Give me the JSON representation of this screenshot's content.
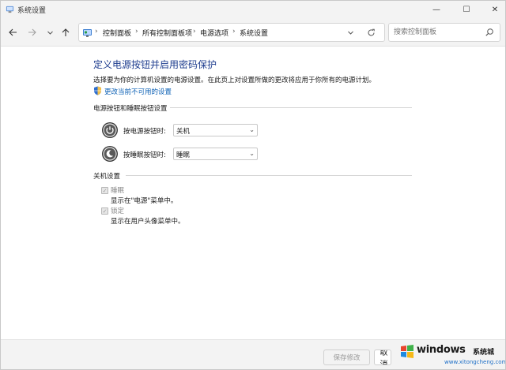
{
  "window": {
    "title": "系统设置",
    "minimize_glyph": "—",
    "maximize_glyph": "☐",
    "close_glyph": "✕"
  },
  "nav": {
    "back_icon": "arrow-left-icon",
    "forward_icon": "arrow-right-icon",
    "recent_icon": "chevron-down-icon",
    "up_icon": "arrow-up-icon"
  },
  "address": {
    "breadcrumbs": [
      "控制面板",
      "所有控制面板项",
      "电源选项",
      "系统设置"
    ],
    "separator": "›"
  },
  "search": {
    "placeholder": "搜索控制面板"
  },
  "main": {
    "title": "定义电源按钮并启用密码保护",
    "description": "选择要为你的计算机设置的电源设置。在此页上对设置所做的更改将应用于你所有的电源计划。",
    "change_link": "更改当前不可用的设置",
    "power_section": {
      "title": "电源按钮和睡眠按钮设置",
      "rows": [
        {
          "label": "按电源按钮时:",
          "value": "关机",
          "icon": "power-button-icon"
        },
        {
          "label": "按睡眠按钮时:",
          "value": "睡眠",
          "icon": "sleep-button-icon"
        }
      ]
    },
    "shutdown_section": {
      "title": "关机设置",
      "options": [
        {
          "label": "睡眠",
          "description": "显示在\"电源\"菜单中。",
          "checked": true,
          "enabled": false
        },
        {
          "label": "锁定",
          "description": "显示在用户头像菜单中。",
          "checked": true,
          "enabled": false
        }
      ]
    }
  },
  "footer": {
    "save_label": "保存修改",
    "cancel_label": "取消"
  },
  "watermark": {
    "brand": "windows",
    "cn": "系统城",
    "url": "www.xitongcheng.com"
  },
  "colors": {
    "title_blue": "#1e3d8f",
    "link_blue": "#0a5fb4",
    "chrome_bg": "#f3f3f3"
  }
}
